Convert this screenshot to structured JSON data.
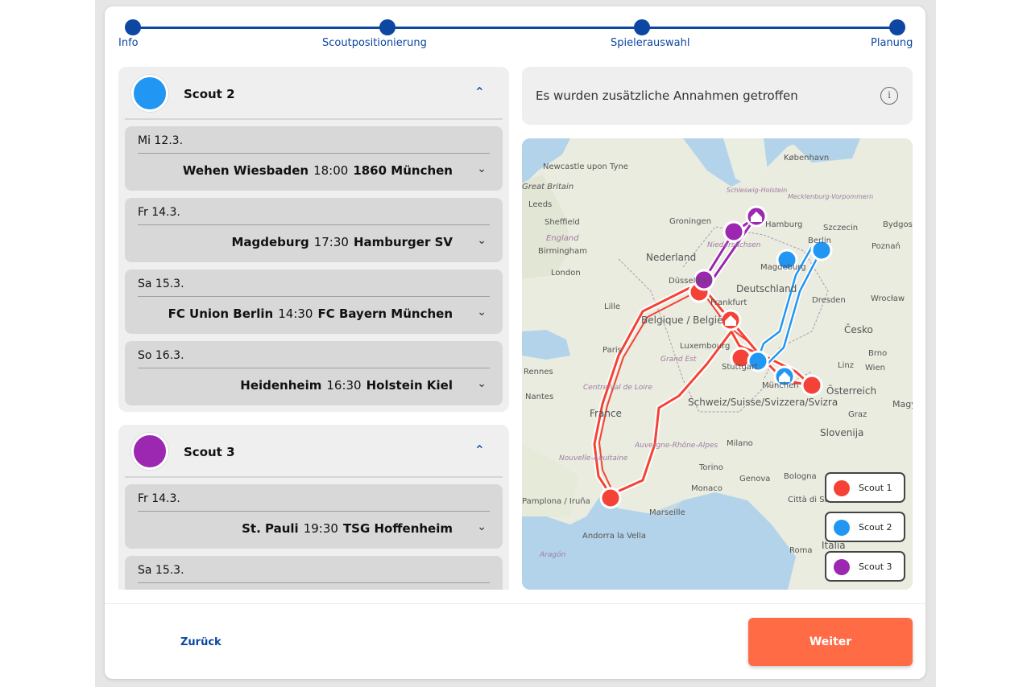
{
  "stepper": {
    "steps": [
      {
        "label": "Info"
      },
      {
        "label": "Scoutpositionierung"
      },
      {
        "label": "Spielerauswahl"
      },
      {
        "label": "Planung"
      }
    ]
  },
  "colors": {
    "primary": "#0d47a1",
    "scout1": "#f44336",
    "scout2": "#2196f3",
    "scout3": "#9c27b0",
    "accent": "#ff6b45"
  },
  "scouts": [
    {
      "name": "Scout 2",
      "color": "#2196f3",
      "matches": [
        {
          "date": "Mi 12.3.",
          "home": "Wehen Wiesbaden",
          "time": "18:00",
          "away": "1860 München"
        },
        {
          "date": "Fr 14.3.",
          "home": "Magdeburg",
          "time": "17:30",
          "away": "Hamburger SV"
        },
        {
          "date": "Sa 15.3.",
          "home": "FC Union Berlin",
          "time": "14:30",
          "away": "FC Bayern München"
        },
        {
          "date": "So 16.3.",
          "home": "Heidenheim",
          "time": "16:30",
          "away": "Holstein Kiel"
        }
      ]
    },
    {
      "name": "Scout 3",
      "color": "#9c27b0",
      "matches": [
        {
          "date": "Fr 14.3.",
          "home": "St. Pauli",
          "time": "19:30",
          "away": "TSG Hoffenheim"
        },
        {
          "date": "Sa 15.3.",
          "home": "",
          "time": "",
          "away": ""
        }
      ]
    }
  ],
  "info": {
    "text": "Es wurden zusätzliche Annahmen getroffen",
    "icon": "info-icon"
  },
  "map": {
    "labels": [
      "København",
      "Newcastle upon Tyne",
      "Great Britain",
      "Leeds",
      "Sheffield",
      "England",
      "Birmingham",
      "London",
      "Groningen",
      "Nederland",
      "Szczecin",
      "Bydgoszcz",
      "Poznań",
      "Schleswig-Holstein",
      "Mecklenburg-Vorpommern",
      "Niedersachsen",
      "Deutschland",
      "Dresden",
      "Wrocław",
      "Belgique / België",
      "Lille",
      "Frankfurt",
      "Luxembourg",
      "Grand Est",
      "Paris",
      "Česko",
      "Brno",
      "Wien",
      "Linz",
      "Rennes",
      "Nantes",
      "Centre-Val de Loire",
      "France",
      "Schweiz/Suisse/Svizzera/Svizra",
      "Österreich",
      "Graz",
      "Slovenija",
      "Magyarország",
      "Milano",
      "Auvergne-Rhône-Alpes",
      "Nouvelle-Aquitaine",
      "Torino",
      "Genova",
      "Bologna",
      "Monaco",
      "Città di San Marino",
      "Marseille",
      "Roma",
      "Italia",
      "Pamplona / Iruña",
      "Andorra la Vella",
      "Aragón",
      "Düsseldorf",
      "Stuttgart",
      "München",
      "Magdeburg",
      "Hamburg",
      "Berlin"
    ],
    "legend": [
      {
        "label": "Scout 1",
        "color": "#f44336"
      },
      {
        "label": "Scout 2",
        "color": "#2196f3"
      },
      {
        "label": "Scout 3",
        "color": "#9c27b0"
      }
    ]
  },
  "footer": {
    "back_label": "Zurück",
    "next_label": "Weiter"
  }
}
